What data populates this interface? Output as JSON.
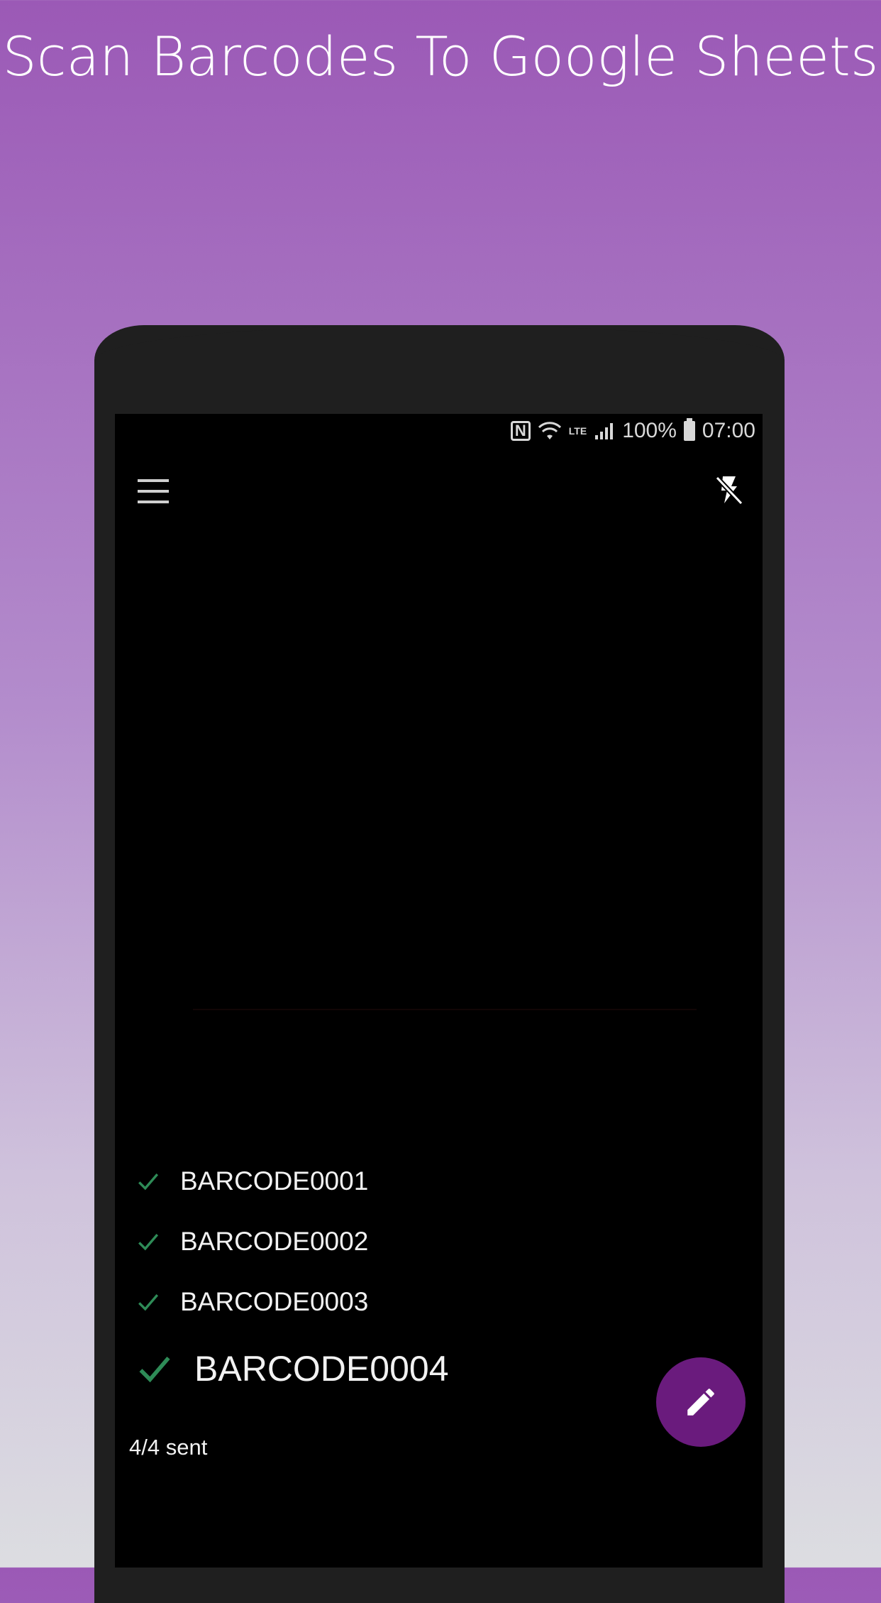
{
  "headline": "Scan Barcodes To Google Sheets",
  "status_bar": {
    "nfc_icon": "nfc-icon",
    "wifi_icon": "wifi-icon",
    "lte_label": "LTE",
    "signal_icon": "signal-icon",
    "battery_percent": "100%",
    "battery_icon": "battery-icon",
    "time": "07:00"
  },
  "toolbar": {
    "menu_icon": "hamburger-menu-icon",
    "flash_icon": "flash-off-icon"
  },
  "scans": [
    {
      "label": "BARCODE0001",
      "status": "sent"
    },
    {
      "label": "BARCODE0002",
      "status": "sent"
    },
    {
      "label": "BARCODE0003",
      "status": "sent"
    },
    {
      "label": "BARCODE0004",
      "status": "sent"
    }
  ],
  "sent_count": "4/4 sent",
  "fab": {
    "icon": "pencil-icon"
  },
  "colors": {
    "accent": "#6a1b7d",
    "check": "#2e8b57",
    "background_top": "#9b59b6"
  }
}
